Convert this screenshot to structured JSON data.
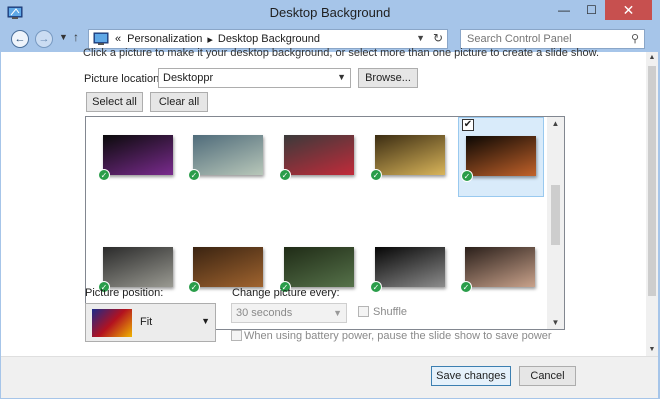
{
  "window": {
    "title": "Desktop Background",
    "minimize_icon": "minimize-icon",
    "maximize_icon": "maximize-icon",
    "close_icon": "close-icon"
  },
  "nav": {
    "back_icon": "back-arrow-icon",
    "forward_icon": "forward-arrow-icon",
    "up_icon": "up-arrow-icon",
    "breadcrumb_sep": "«",
    "crumb1": "Personalization",
    "crumb_arrow": "▸",
    "crumb2": "Desktop Background",
    "search_placeholder": "Search Control Panel"
  },
  "content": {
    "intro_text": "Click a picture to make it your desktop background, or select more than one picture to create a slide show.",
    "picture_location_label": "Picture location:",
    "picture_location_value": "Desktoppr",
    "browse_label": "Browse...",
    "select_all_label": "Select all",
    "clear_all_label": "Clear all",
    "pictures": [
      {
        "name": "glowing-orb-dark",
        "checked": true,
        "selected": false,
        "c1": "#0a0a0a",
        "c2": "#7a2b8e"
      },
      {
        "name": "sea-sky-horizon",
        "checked": true,
        "selected": false,
        "c1": "#4f6b7a",
        "c2": "#b8c7b9"
      },
      {
        "name": "red-heart-grey",
        "checked": true,
        "selected": false,
        "c1": "#3a3a3a",
        "c2": "#c22b3a"
      },
      {
        "name": "car-sunset-field",
        "checked": true,
        "selected": false,
        "c1": "#3b2c12",
        "c2": "#d9b55a"
      },
      {
        "name": "planet-space",
        "checked": true,
        "selected": true,
        "c1": "#0b0703",
        "c2": "#c2622a"
      },
      {
        "name": "stormy-sky-road",
        "checked": true,
        "selected": false,
        "c1": "#2a2a2a",
        "c2": "#9a9a92"
      },
      {
        "name": "ornate-spheres",
        "checked": true,
        "selected": false,
        "c1": "#3a2311",
        "c2": "#a0642f"
      },
      {
        "name": "forest-tree",
        "checked": true,
        "selected": false,
        "c1": "#1f2b16",
        "c2": "#56724a"
      },
      {
        "name": "face-monochrome",
        "checked": true,
        "selected": false,
        "c1": "#060606",
        "c2": "#8c8c8c"
      },
      {
        "name": "dusk-hills",
        "checked": true,
        "selected": false,
        "c1": "#2a1f1a",
        "c2": "#c9a28b"
      }
    ],
    "picture_position_label": "Picture position:",
    "picture_position_value": "Fit",
    "change_every_label": "Change picture every:",
    "change_every_value": "30 seconds",
    "shuffle_label": "Shuffle",
    "battery_label": "When using battery power, pause the slide show to save power"
  },
  "footer": {
    "save_label": "Save changes",
    "cancel_label": "Cancel"
  },
  "colors": {
    "title_bar": "#a6c5e9",
    "close_button": "#c7504f",
    "check_green": "#2a9d4a",
    "selected_tile": "#d9ebfa"
  }
}
